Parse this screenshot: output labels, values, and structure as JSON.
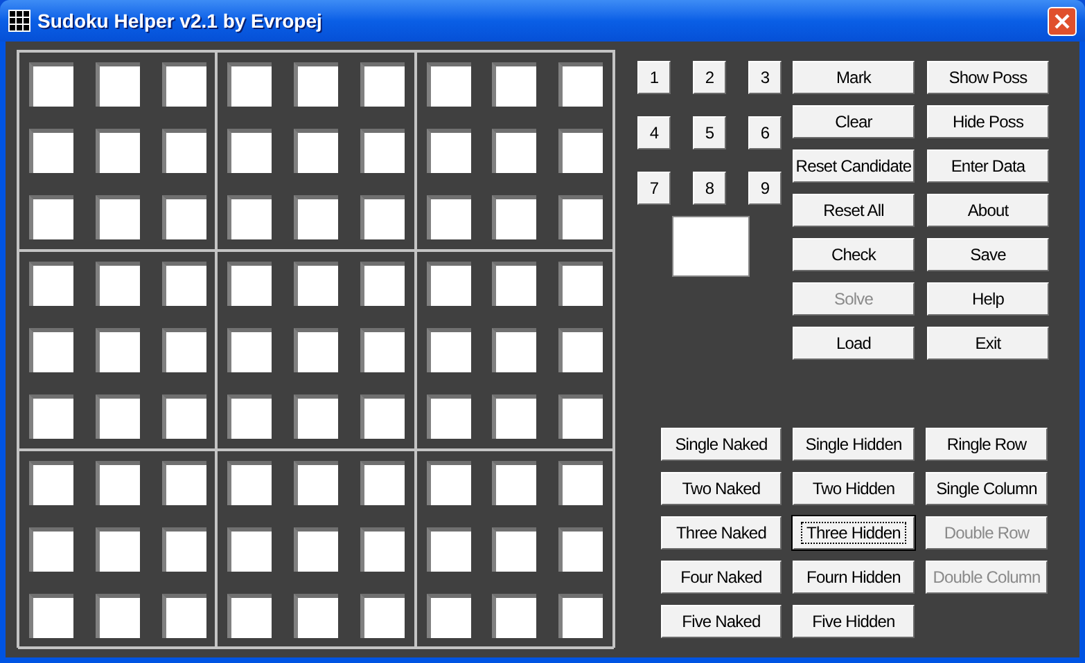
{
  "window": {
    "title": "Sudoku Helper v2.1 by Evropej"
  },
  "number_buttons": [
    "1",
    "2",
    "3",
    "4",
    "5",
    "6",
    "7",
    "8",
    "9"
  ],
  "action_buttons": [
    {
      "label": "Mark",
      "disabled": false
    },
    {
      "label": "Show Poss",
      "disabled": false
    },
    {
      "label": "Clear",
      "disabled": false
    },
    {
      "label": "Hide Poss",
      "disabled": false
    },
    {
      "label": "Reset Candidate",
      "disabled": false
    },
    {
      "label": "Enter Data",
      "disabled": false
    },
    {
      "label": "Reset All",
      "disabled": false
    },
    {
      "label": "About",
      "disabled": false
    },
    {
      "label": "Check",
      "disabled": false
    },
    {
      "label": "Save",
      "disabled": false
    },
    {
      "label": "Solve",
      "disabled": true
    },
    {
      "label": "Help",
      "disabled": false
    },
    {
      "label": "Load",
      "disabled": false
    },
    {
      "label": "Exit",
      "disabled": false
    }
  ],
  "technique_buttons": [
    {
      "label": "Single Naked",
      "disabled": false,
      "focused": false
    },
    {
      "label": "Single Hidden",
      "disabled": false,
      "focused": false
    },
    {
      "label": "Ringle Row",
      "disabled": false,
      "focused": false
    },
    {
      "label": "Two Naked",
      "disabled": false,
      "focused": false
    },
    {
      "label": "Two Hidden",
      "disabled": false,
      "focused": false
    },
    {
      "label": "Single Column",
      "disabled": false,
      "focused": false
    },
    {
      "label": "Three Naked",
      "disabled": false,
      "focused": false
    },
    {
      "label": "Three Hidden",
      "disabled": false,
      "focused": true
    },
    {
      "label": "Double Row",
      "disabled": true,
      "focused": false
    },
    {
      "label": "Four Naked",
      "disabled": false,
      "focused": false
    },
    {
      "label": "Fourn Hidden",
      "disabled": false,
      "focused": false
    },
    {
      "label": "Double Column",
      "disabled": true,
      "focused": false
    },
    {
      "label": "Five Naked",
      "disabled": false,
      "focused": false
    },
    {
      "label": "Five Hidden",
      "disabled": false,
      "focused": false
    }
  ]
}
